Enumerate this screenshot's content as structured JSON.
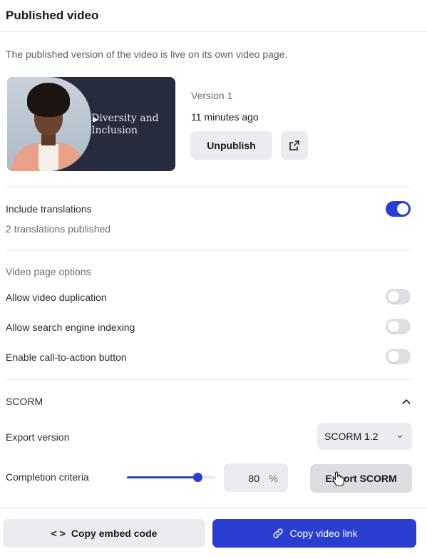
{
  "header": {
    "title": "Published video"
  },
  "description": "The published version of the video is live on its own video page.",
  "video": {
    "thumbnail_title": "Diversity and Inclusion",
    "version": "Version 1",
    "published_ago": "11 minutes ago",
    "unpublish_label": "Unpublish",
    "open_icon": "external-link-icon"
  },
  "translations": {
    "label": "Include translations",
    "sublabel": "2 translations published",
    "enabled": true
  },
  "video_page_options": {
    "heading": "Video page options",
    "options": [
      {
        "label": "Allow video duplication",
        "enabled": false
      },
      {
        "label": "Allow search engine indexing",
        "enabled": false
      },
      {
        "label": "Enable call-to-action button",
        "enabled": false
      }
    ]
  },
  "scorm": {
    "heading": "SCORM",
    "expanded": true,
    "export_version_label": "Export version",
    "export_version_value": "SCORM 1.2",
    "completion_label": "Completion criteria",
    "completion_value": "80",
    "completion_unit": "%",
    "export_button": "Export SCORM"
  },
  "footer": {
    "embed_label": "Copy embed code",
    "embed_icon": "code-icon",
    "link_label": "Copy video link",
    "link_icon": "link-icon"
  },
  "colors": {
    "accent": "#2a3fd1",
    "toggle_off": "#dedee3",
    "button_bg": "#ececf0"
  }
}
